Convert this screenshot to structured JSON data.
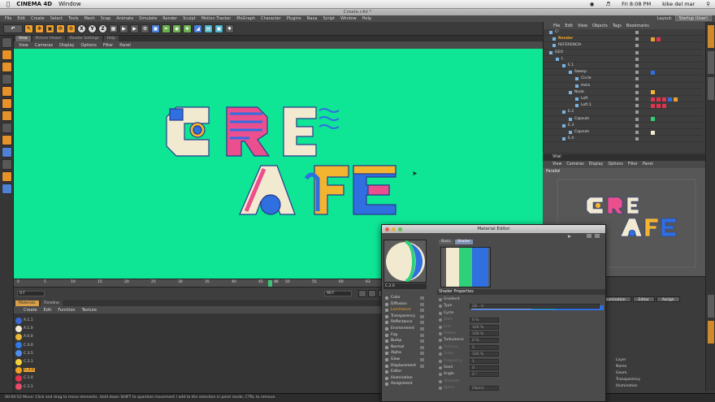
{
  "mac": {
    "app": "CINEMA 4D",
    "window_menu": "Window",
    "time": "Fri 8:08 PM",
    "user": "kike del mar"
  },
  "window": {
    "title": "Create.c4d *"
  },
  "menubar": {
    "items": [
      "File",
      "Edit",
      "Create",
      "Select",
      "Tools",
      "Mesh",
      "Snap",
      "Animate",
      "Simulate",
      "Render",
      "Sculpt",
      "Motion Tracker",
      "MoGraph",
      "Character",
      "Plugins",
      "Naxa",
      "Script",
      "Window",
      "Help"
    ],
    "layout_label": "Layout:",
    "layout_value": "Startup (User)"
  },
  "viewport": {
    "tabs": [
      "View",
      "Picture Viewer",
      "Render Settings",
      "Help"
    ],
    "menu": [
      "View",
      "Cameras",
      "Display",
      "Options",
      "Filter",
      "Panel"
    ]
  },
  "timeline": {
    "ticks": [
      "0",
      "5",
      "10",
      "15",
      "20",
      "25",
      "30",
      "35",
      "40",
      "45",
      "50",
      "55",
      "60",
      "63"
    ],
    "marker": "46",
    "start_field": "0 F",
    "end_field": "90 F"
  },
  "material_manager": {
    "tabs": [
      "Materials",
      "Timeline"
    ],
    "menu": [
      "Create",
      "Edit",
      "Function",
      "Texture"
    ],
    "materials": [
      {
        "name": "A.1.1",
        "color": "#3a66d8"
      },
      {
        "name": "A.1.0",
        "color": "#f2ead0"
      },
      {
        "name": "A.0.0",
        "color": "#e8b832"
      },
      {
        "name": "C.0.0",
        "color": "#2f7ae5"
      },
      {
        "name": "C.3.5",
        "color": "#4f8ef0"
      },
      {
        "name": "C.2.1",
        "color": "#f0d23a"
      },
      {
        "name": "C.2.0",
        "color": "#f2a420"
      },
      {
        "name": "C.1.0",
        "color": "#e2334f"
      },
      {
        "name": "C.1.1",
        "color": "#e84a6a"
      }
    ],
    "selected": "C.2.0"
  },
  "status": {
    "text": "00:00:52   Move: Click and drag to move elements. Hold down SHIFT to quantize movement / add to the selection in point mode, CTRL to remove."
  },
  "objects": {
    "menu": [
      "File",
      "Edit",
      "View",
      "Objects",
      "Tags",
      "Bookmarks"
    ],
    "rows": [
      {
        "name": "C!",
        "indent": 14,
        "hl": false
      },
      {
        "name": "Render",
        "indent": 18,
        "hl": true
      },
      {
        "name": "REFERENCIA",
        "indent": 18,
        "hl": false
      },
      {
        "name": "GEO",
        "indent": 14,
        "hl": false
      },
      {
        "name": "L",
        "indent": 22,
        "hl": false
      },
      {
        "name": "E.1",
        "indent": 30,
        "hl": false
      },
      {
        "name": "Sweep",
        "indent": 38,
        "hl": false
      },
      {
        "name": "Circle",
        "indent": 46,
        "hl": false
      },
      {
        "name": "Helix",
        "indent": 46,
        "hl": false
      },
      {
        "name": "Noob",
        "indent": 38,
        "hl": false
      },
      {
        "name": "Loft",
        "indent": 46,
        "hl": false
      },
      {
        "name": "Loft.1",
        "indent": 46,
        "hl": false
      },
      {
        "name": "E.2",
        "indent": 30,
        "hl": false
      },
      {
        "name": "Capsule",
        "indent": 38,
        "hl": false
      },
      {
        "name": "E.3",
        "indent": 30,
        "hl": false
      },
      {
        "name": "Capsule",
        "indent": 38,
        "hl": false
      },
      {
        "name": "E.4",
        "indent": 30,
        "hl": false
      }
    ]
  },
  "viewport2": {
    "header": "Vital",
    "menu": [
      "View",
      "Cameras",
      "Display",
      "Options",
      "Filter",
      "Panel"
    ],
    "camera": "Parallel"
  },
  "attributes": {
    "buttons": [
      "Illumination",
      "Editor",
      "Assign"
    ],
    "rows": [
      "Layer",
      "Name",
      "Geom.",
      "Transparency",
      "Illumination"
    ]
  },
  "material_editor": {
    "title": "Material Editor",
    "name": "C.2.0",
    "tabs": [
      "Basic",
      "Shader"
    ],
    "channels": [
      "Color",
      "Diffusion",
      "Luminance",
      "Transparency",
      "Reflectance",
      "Environment",
      "Fog",
      "Bump",
      "Normal",
      "Alpha",
      "Glow",
      "Displacement",
      "Editor",
      "Illumination",
      "Assignment"
    ],
    "selected_channel": "Luminance",
    "section": "Shader Properties",
    "props": [
      {
        "label": "Gradient",
        "value": ""
      },
      {
        "label": "Type",
        "value": "2D - U"
      },
      {
        "label": "Cycle",
        "value": ""
      },
      {
        "label": "Start",
        "value": "0 %"
      },
      {
        "label": "End",
        "value": "100 %"
      },
      {
        "label": "Radius",
        "value": "100 %"
      },
      {
        "label": "Turbulence",
        "value": "0 %"
      },
      {
        "label": "Octaves",
        "value": "5"
      },
      {
        "label": "Scale",
        "value": "100 %"
      },
      {
        "label": "Frequency",
        "value": "1"
      },
      {
        "label": "Seed",
        "value": "0"
      },
      {
        "label": "Angle",
        "value": "0 °"
      },
      {
        "label": "Absolute",
        "value": ""
      },
      {
        "label": "Space",
        "value": "Object"
      }
    ]
  },
  "colors": {
    "viewport_bg": "#0ee696",
    "accent": "#f5a623",
    "blue": "#2f6fe0",
    "pink": "#ec4f8e",
    "yellow": "#f3b430",
    "cream": "#f2ead0",
    "green": "#2ed07a"
  }
}
